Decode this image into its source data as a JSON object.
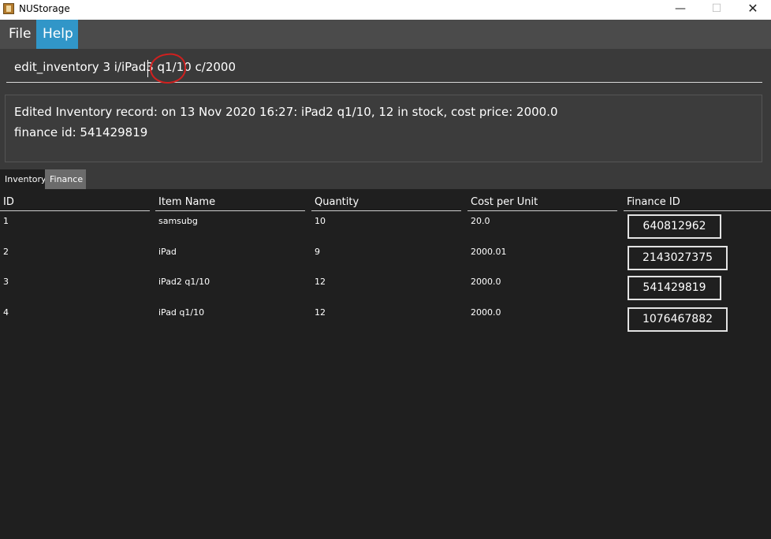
{
  "window": {
    "title": "NUStorage",
    "minimize_glyph": "—",
    "maximize_glyph": "☐",
    "close_glyph": "✕"
  },
  "menu": {
    "file": "File",
    "help": "Help"
  },
  "command_box": {
    "value": "edit_inventory 3 i/iPad3 q1/10 c/2000"
  },
  "result": {
    "line1": "Edited Inventory record: on 13 Nov 2020 16:27: iPad2 q1/10, 12 in stock, cost price: 2000.0",
    "line2": "finance id: 541429819"
  },
  "tabs": {
    "inventory": "Inventory",
    "finance": "Finance"
  },
  "table": {
    "headers": [
      "ID",
      "Item Name",
      "Quantity",
      "Cost per Unit",
      "Finance ID"
    ],
    "rows": [
      {
        "id": "1",
        "name": "samsubg",
        "quantity": "10",
        "cost": "20.0",
        "finance_id": "640812962"
      },
      {
        "id": "2",
        "name": "iPad",
        "quantity": "9",
        "cost": "2000.01",
        "finance_id": "2143027375"
      },
      {
        "id": "3",
        "name": "iPad2 q1/10",
        "quantity": "12",
        "cost": "2000.0",
        "finance_id": "541429819"
      },
      {
        "id": "4",
        "name": "iPad q1/10",
        "quantity": "12",
        "cost": "2000.0",
        "finance_id": "1076467882"
      }
    ]
  },
  "colors": {
    "menu_active": "#3196c8",
    "background": "#1f1f1f",
    "panel": "#3a3a3a",
    "annotation": "#d0201f"
  }
}
